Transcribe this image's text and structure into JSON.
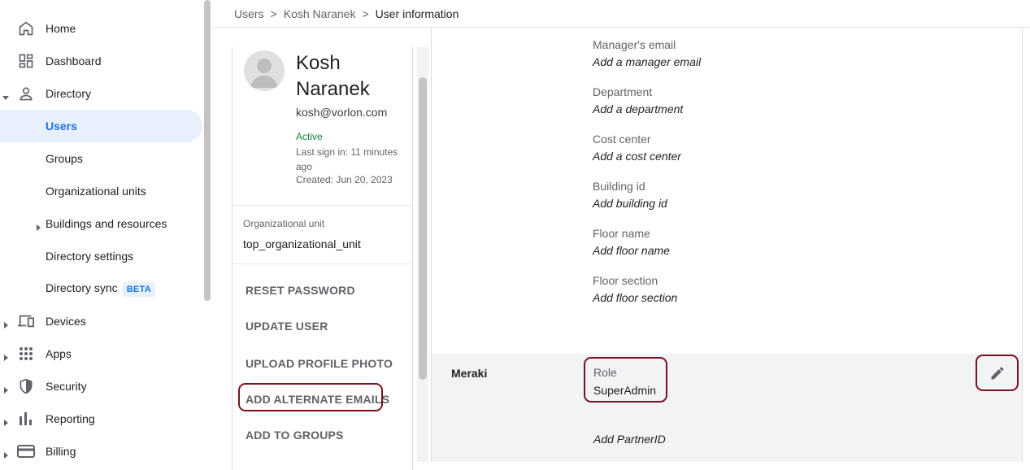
{
  "nav": {
    "items": [
      {
        "label": "Home",
        "icon": "home-icon"
      },
      {
        "label": "Dashboard",
        "icon": "dashboard-icon"
      },
      {
        "label": "Directory",
        "icon": "person-icon"
      },
      {
        "label": "Users"
      },
      {
        "label": "Groups"
      },
      {
        "label": "Organizational units"
      },
      {
        "label": "Buildings and resources"
      },
      {
        "label": "Directory settings"
      },
      {
        "label": "Directory sync",
        "badge": "BETA"
      },
      {
        "label": "Devices",
        "icon": "devices-icon"
      },
      {
        "label": "Apps",
        "icon": "apps-grid-icon"
      },
      {
        "label": "Security",
        "icon": "shield-icon"
      },
      {
        "label": "Reporting",
        "icon": "bar-chart-icon"
      },
      {
        "label": "Billing",
        "icon": "credit-card-icon"
      }
    ]
  },
  "breadcrumb": [
    "Users",
    "Kosh Naranek",
    "User information"
  ],
  "profile": {
    "name": "Kosh Naranek",
    "email": "kosh@vorlon.com",
    "status": "Active",
    "last_sign_in": "Last sign in: 11 minutes ago",
    "created": "Created: Jun 20, 2023",
    "org_unit_label": "Organizational unit",
    "org_unit_value": "top_organizational_unit",
    "actions": [
      "RESET PASSWORD",
      "UPDATE USER",
      "UPLOAD PROFILE PHOTO",
      "ADD ALTERNATE EMAILS",
      "ADD TO GROUPS"
    ]
  },
  "fields": [
    {
      "label": "Manager's email",
      "value": "Add a manager email"
    },
    {
      "label": "Department",
      "value": "Add a department"
    },
    {
      "label": "Cost center",
      "value": "Add a cost center"
    },
    {
      "label": "Building id",
      "value": "Add building id"
    },
    {
      "label": "Floor name",
      "value": "Add floor name"
    },
    {
      "label": "Floor section",
      "value": "Add floor section"
    }
  ],
  "meraki": {
    "title": "Meraki",
    "role_label": "Role",
    "role_value": "SuperAdmin",
    "partner_placeholder": "Add PartnerID"
  },
  "colors": {
    "accent": "#1a73e8",
    "active_status": "#188038",
    "highlight_outline": "#7b1020"
  }
}
